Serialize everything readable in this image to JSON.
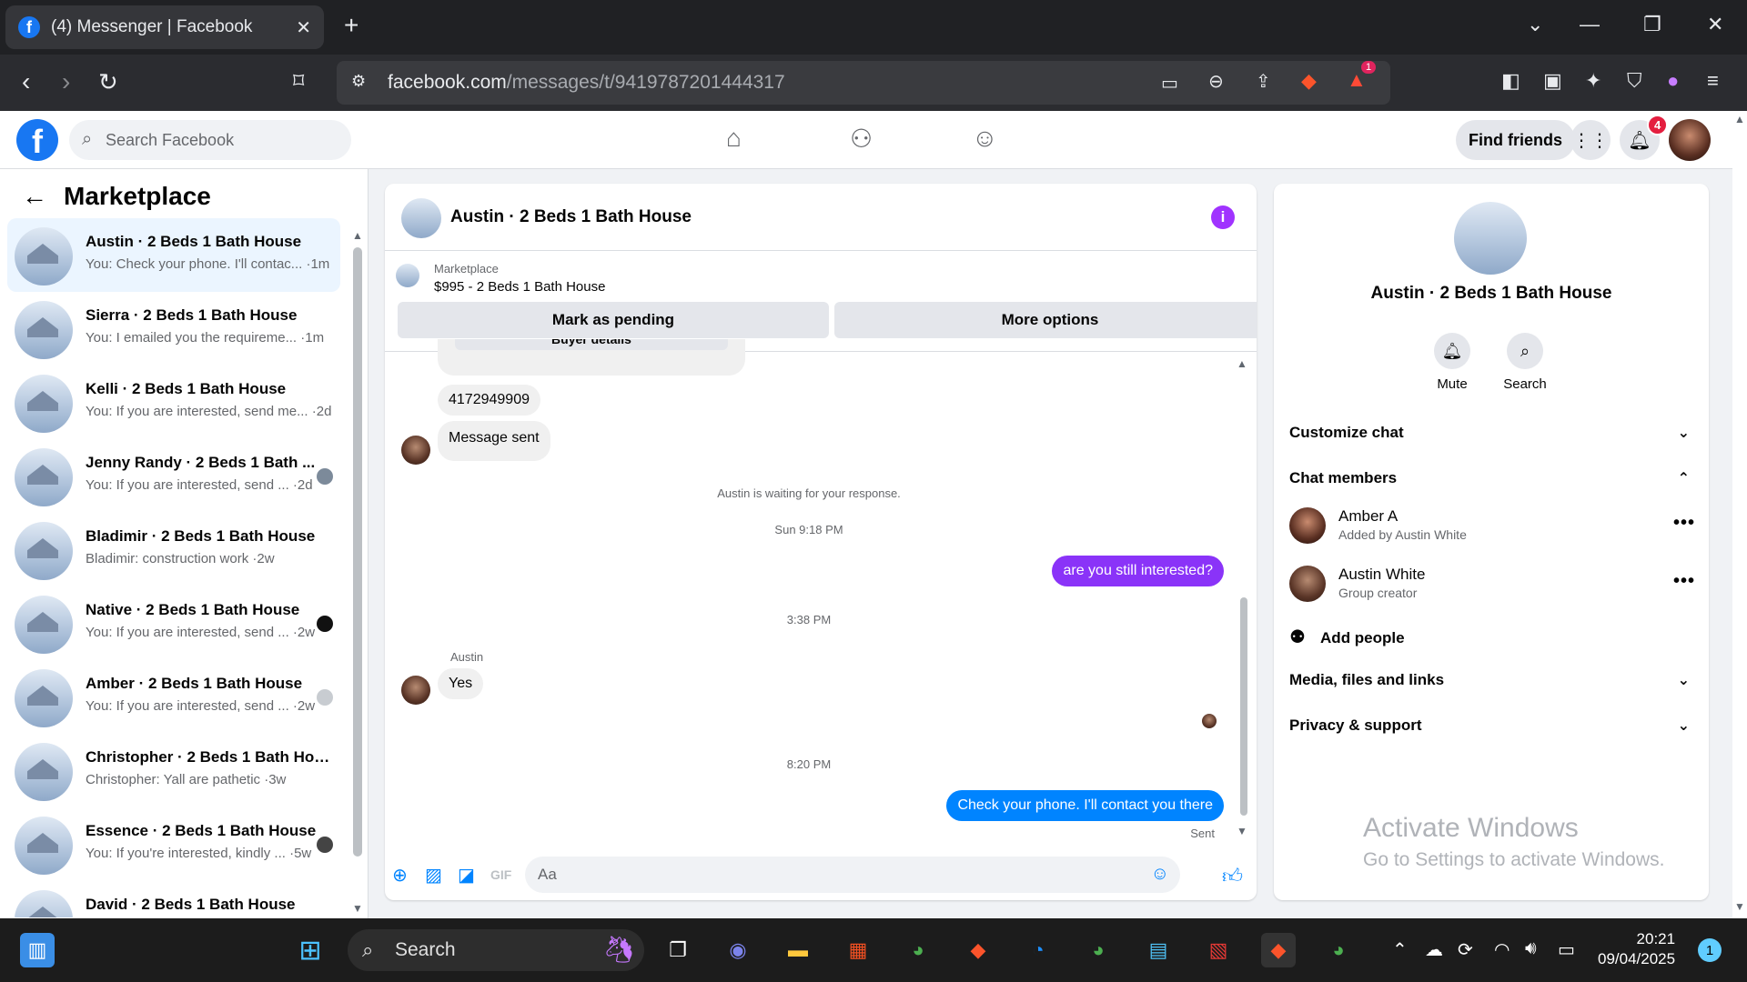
{
  "browser": {
    "tab_title": "(4) Messenger | Facebook",
    "url_domain": "facebook.com",
    "url_path": "/messages/t/9419787201444317",
    "brave_badge": "1"
  },
  "fb": {
    "search_placeholder": "Search Facebook",
    "find_friends": "Find friends",
    "notif_count": "4"
  },
  "sidebar": {
    "title": "Marketplace",
    "conversations": [
      {
        "name": "Austin · 2 Beds 1 Bath House",
        "preview": "You: Check your phone. I'll contac... ·1m"
      },
      {
        "name": "Sierra · 2 Beds 1 Bath House",
        "preview": "You: I emailed you the requireme... ·1m"
      },
      {
        "name": "Kelli · 2 Beds 1 Bath House",
        "preview": "You: If you are interested, send me... ·2d"
      },
      {
        "name": "Jenny Randy · 2 Beds 1 Bath ...",
        "preview": "You: If you are interested, send ... ·2d"
      },
      {
        "name": "Bladimir · 2 Beds 1 Bath House",
        "preview": "Bladimir: construction work ·2w"
      },
      {
        "name": "Native · 2 Beds 1 Bath House",
        "preview": "You: If you are interested, send ... ·2w"
      },
      {
        "name": "Amber · 2 Beds 1 Bath House",
        "preview": "You: If you are interested, send ... ·2w"
      },
      {
        "name": "Christopher · 2 Beds 1 Bath Hou...",
        "preview": "Christopher: Yall are pathetic ·3w"
      },
      {
        "name": "Essence · 2 Beds 1 Bath House",
        "preview": "You: If you're interested, kindly ... ·5w"
      },
      {
        "name": "David · 2 Beds 1 Bath House",
        "preview": ""
      }
    ]
  },
  "chat": {
    "title": "Austin · 2 Beds 1 Bath House",
    "listing_label": "Marketplace",
    "listing_price": "$995 - 2 Beds 1 Bath House",
    "btn_pending": "Mark as pending",
    "btn_more": "More options",
    "msg_partial": "Buyer details",
    "msg_phone": "4172949909",
    "msg_sent_notice": "Message sent",
    "waiting": "Austin is waiting for your response.",
    "time1": "Sun 9:18 PM",
    "msg_interest": "are you still interested?",
    "time2": "3:38 PM",
    "sender_name": "Austin",
    "msg_yes": "Yes",
    "time3": "8:20 PM",
    "msg_contact": "Check your phone. I'll contact you there",
    "sent_status": "Sent",
    "composer_placeholder": "Aa"
  },
  "details": {
    "title": "Austin · 2 Beds 1 Bath House",
    "mute": "Mute",
    "search": "Search",
    "customize": "Customize chat",
    "members_header": "Chat members",
    "members": [
      {
        "name": "Amber A",
        "sub": "Added by Austin White"
      },
      {
        "name": "Austin White",
        "sub": "Group creator"
      }
    ],
    "add_people": "Add people",
    "media": "Media, files and links",
    "privacy": "Privacy & support"
  },
  "watermark": {
    "line1": "Activate Windows",
    "line2": "Go to Settings to activate Windows."
  },
  "taskbar": {
    "search": "Search",
    "time": "20:21",
    "date": "09/04/2025",
    "notif": "1"
  }
}
